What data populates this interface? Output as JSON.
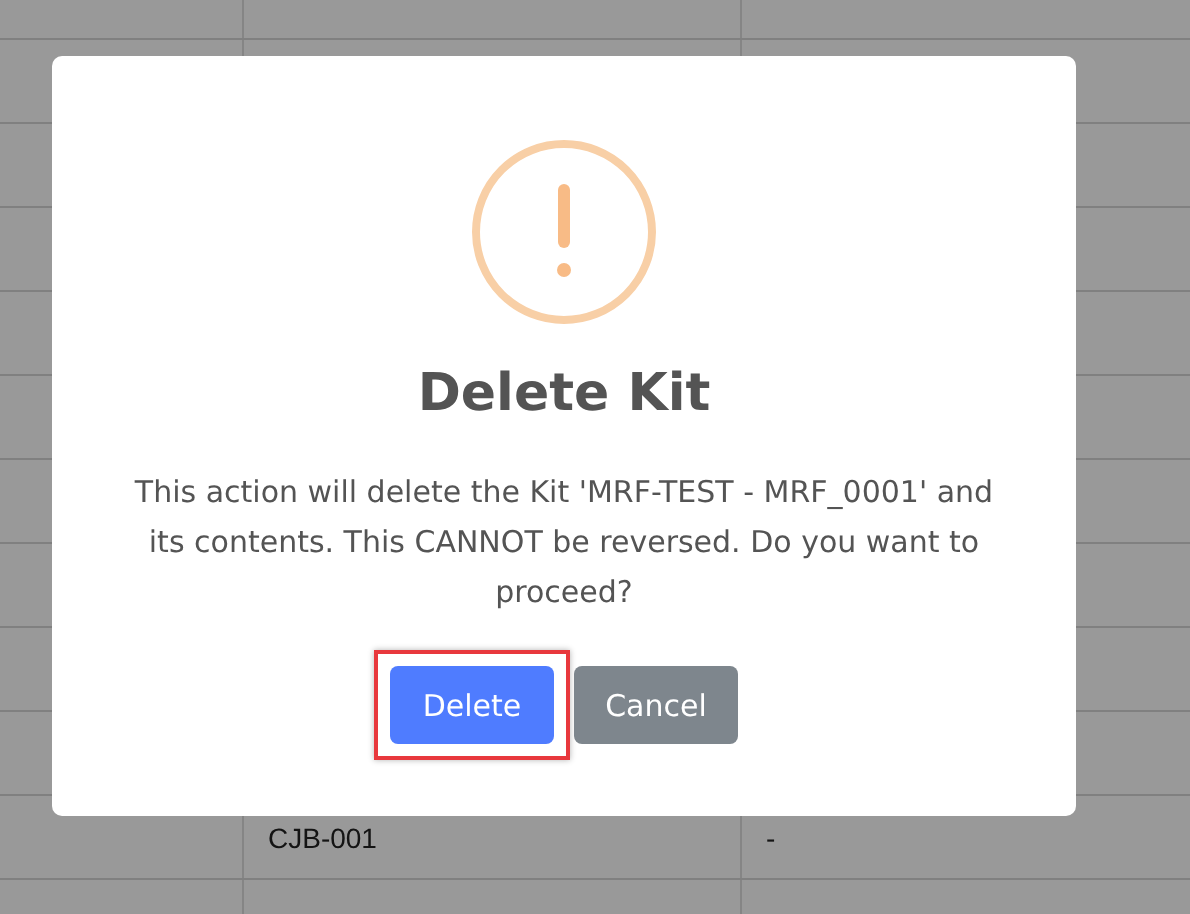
{
  "table": {
    "rows": [
      {
        "column_2": "CJB-001",
        "column_3": "-"
      }
    ]
  },
  "dialog": {
    "title": "Delete Kit",
    "message": "This action will delete the Kit 'MRF-TEST - MRF_0001' and its contents. This CANNOT be reversed. Do you want to proceed?",
    "buttons": [
      {
        "label": "Delete",
        "kind": "primary",
        "focused": true
      },
      {
        "label": "Cancel",
        "kind": "secondary",
        "focused": false
      }
    ]
  }
}
